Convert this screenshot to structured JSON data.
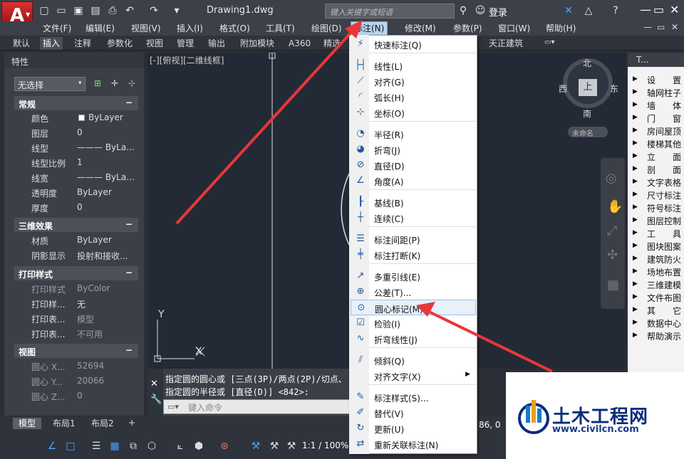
{
  "title_bar": {
    "doc_title": "Drawing1.dwg",
    "search_placeholder": "键入关键字或短语",
    "login": "登录"
  },
  "menubar": [
    "文件(F)",
    "编辑(E)",
    "视图(V)",
    "插入(I)",
    "格式(O)",
    "工具(T)",
    "绘图(D)",
    "标注(N)",
    "修改(M)",
    "参数(P)",
    "窗口(W)",
    "帮助(H)"
  ],
  "ribbon_tabs": [
    "默认",
    "插入",
    "注释",
    "参数化",
    "视图",
    "管理",
    "输出",
    "附加模块",
    "A360",
    "精选",
    "天正建筑"
  ],
  "properties": {
    "title": "特性",
    "selection": "无选择",
    "sections": [
      {
        "name": "常规",
        "rows": [
          [
            "颜色",
            "ByLayer"
          ],
          [
            "图层",
            "0"
          ],
          [
            "线型",
            "——— ByLa..."
          ],
          [
            "线型比例",
            "1"
          ],
          [
            "线宽",
            "——— ByLa..."
          ],
          [
            "透明度",
            "ByLayer"
          ],
          [
            "厚度",
            "0"
          ]
        ]
      },
      {
        "name": "三维效果",
        "rows": [
          [
            "材质",
            "ByLayer"
          ],
          [
            "阴影显示",
            "投射和接收..."
          ]
        ]
      },
      {
        "name": "打印样式",
        "rows": [
          [
            "打印样式",
            "ByColor"
          ],
          [
            "打印样...",
            "无"
          ],
          [
            "打印表...",
            "模型"
          ],
          [
            "打印表...",
            "不可用"
          ]
        ]
      },
      {
        "name": "视图",
        "rows": [
          [
            "圆心 X...",
            "52694"
          ],
          [
            "圆心 Y...",
            "20066"
          ],
          [
            "圆心 Z...",
            "0"
          ]
        ]
      }
    ]
  },
  "canvas": {
    "viewport_label": "[-][俯视][二维线框]",
    "compass": {
      "n": "北",
      "s": "南",
      "e": "东",
      "w": "西",
      "center": "上",
      "ucs": "未命名"
    },
    "axis_y": "Y",
    "axis_x": "X"
  },
  "tianzheng": {
    "title": "T...",
    "items": [
      "设　　置",
      "轴网柱子",
      "墙　　体",
      "门　　窗",
      "房间屋顶",
      "楼梯其他",
      "立　　面",
      "剖　　面",
      "文字表格",
      "尺寸标注",
      "符号标注",
      "图层控制",
      "工　　具",
      "图块图案",
      "建筑防火",
      "场地布置",
      "三维建模",
      "文件布图",
      "其　　它",
      "数据中心",
      "帮助演示"
    ]
  },
  "command": {
    "line1": "指定圆的圆心或 [三点(3P)/两点(2P)/切点、",
    "line2": "指定圆的半径或 [直径(D)] <842>:",
    "placeholder": "键入命令"
  },
  "layout_tabs": [
    "模型",
    "布局1",
    "布局2"
  ],
  "status": {
    "scale": "1:1 / 100%",
    "coords": "86, 0"
  },
  "dropdown": {
    "items": [
      {
        "label": "快速标注(Q)",
        "icon": "quick-dim-icon",
        "glyph": "⚡"
      },
      {
        "label": "线性(L)",
        "icon": "linear-dim-icon",
        "glyph": "├┤"
      },
      {
        "label": "对齐(G)",
        "icon": "aligned-dim-icon",
        "glyph": "⟋"
      },
      {
        "label": "弧长(H)",
        "icon": "arc-length-icon",
        "glyph": "◜"
      },
      {
        "label": "坐标(O)",
        "icon": "ordinate-icon",
        "glyph": "⊹"
      },
      {
        "label": "半径(R)",
        "icon": "radius-icon",
        "glyph": "◔"
      },
      {
        "label": "折弯(J)",
        "icon": "jogged-icon",
        "glyph": "◕"
      },
      {
        "label": "直径(D)",
        "icon": "diameter-icon",
        "glyph": "⊘"
      },
      {
        "label": "角度(A)",
        "icon": "angle-icon",
        "glyph": "∠"
      },
      {
        "label": "基线(B)",
        "icon": "baseline-icon",
        "glyph": "┠"
      },
      {
        "label": "连续(C)",
        "icon": "continue-icon",
        "glyph": "┼"
      },
      {
        "label": "标注间距(P)",
        "icon": "dim-space-icon",
        "glyph": "☰"
      },
      {
        "label": "标注打断(K)",
        "icon": "dim-break-icon",
        "glyph": "╪"
      },
      {
        "label": "多重引线(E)",
        "icon": "mleader-icon",
        "glyph": "↗"
      },
      {
        "label": "公差(T)...",
        "icon": "tolerance-icon",
        "glyph": "⊕"
      },
      {
        "label": "圆心标记(M)",
        "icon": "center-mark-icon",
        "glyph": "⊙"
      },
      {
        "label": "检验(I)",
        "icon": "inspect-icon",
        "glyph": "☑"
      },
      {
        "label": "折弯线性(J)",
        "icon": "jog-line-icon",
        "glyph": "∿"
      },
      {
        "label": "倾斜(Q)",
        "icon": "oblique-icon",
        "glyph": "⫽"
      },
      {
        "label": "对齐文字(X)",
        "icon": "",
        "glyph": ""
      },
      {
        "label": "标注样式(S)...",
        "icon": "dim-style-icon",
        "glyph": "✎"
      },
      {
        "label": "替代(V)",
        "icon": "override-icon",
        "glyph": "✐"
      },
      {
        "label": "更新(U)",
        "icon": "update-icon",
        "glyph": "↻"
      },
      {
        "label": "重新关联标注(N)",
        "icon": "reassociate-icon",
        "glyph": "⇄"
      }
    ]
  },
  "watermark": {
    "title": "土木工程网",
    "url": "www.civilcn.com"
  },
  "colors": {
    "arrow": "#e8373a",
    "menu_active": "#b9d3ee",
    "canvas": "#232a36"
  }
}
